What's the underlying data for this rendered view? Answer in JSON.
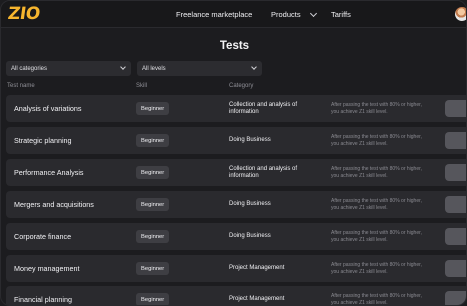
{
  "header": {
    "logo": "ZIO",
    "nav": {
      "marketplace": "Freelance marketplace",
      "products": "Products",
      "tariffs": "Tariffs"
    }
  },
  "page": {
    "title": "Tests"
  },
  "filters": {
    "category": "All categories",
    "level": "All levels"
  },
  "columns": {
    "name": "Test name",
    "skill": "Skill",
    "category": "Category"
  },
  "rows": [
    {
      "name": "Analysis of variations",
      "skill": "Beginner",
      "category": "Collection and analysis of information",
      "note": "After passing the test with 80% or higher, you achieve Z1 skill level."
    },
    {
      "name": "Strategic planning",
      "skill": "Beginner",
      "category": "Doing Business",
      "note": "After passing the test with 80% or higher, you achieve Z1 skill level."
    },
    {
      "name": "Performance Analysis",
      "skill": "Beginner",
      "category": "Collection and analysis of information",
      "note": "After passing the test with 80% or higher, you achieve Z1 skill level."
    },
    {
      "name": "Mergers and acquisitions",
      "skill": "Beginner",
      "category": "Doing Business",
      "note": "After passing the test with 80% or higher, you achieve Z1 skill level."
    },
    {
      "name": "Corporate finance",
      "skill": "Beginner",
      "category": "Doing Business",
      "note": "After passing the test with 80% or higher, you achieve Z1 skill level."
    },
    {
      "name": "Money management",
      "skill": "Beginner",
      "category": "Project Management",
      "note": "After passing the test with 80% or higher, you achieve Z1 skill level."
    },
    {
      "name": "Financial planning",
      "skill": "Beginner",
      "category": "Project Management",
      "note": "After passing the test with 80% or higher, you achieve Z1 skill level."
    }
  ],
  "colors": {
    "background": "#1c1c1f",
    "row": "#2a2a2e",
    "brand": "#f6b52e"
  }
}
